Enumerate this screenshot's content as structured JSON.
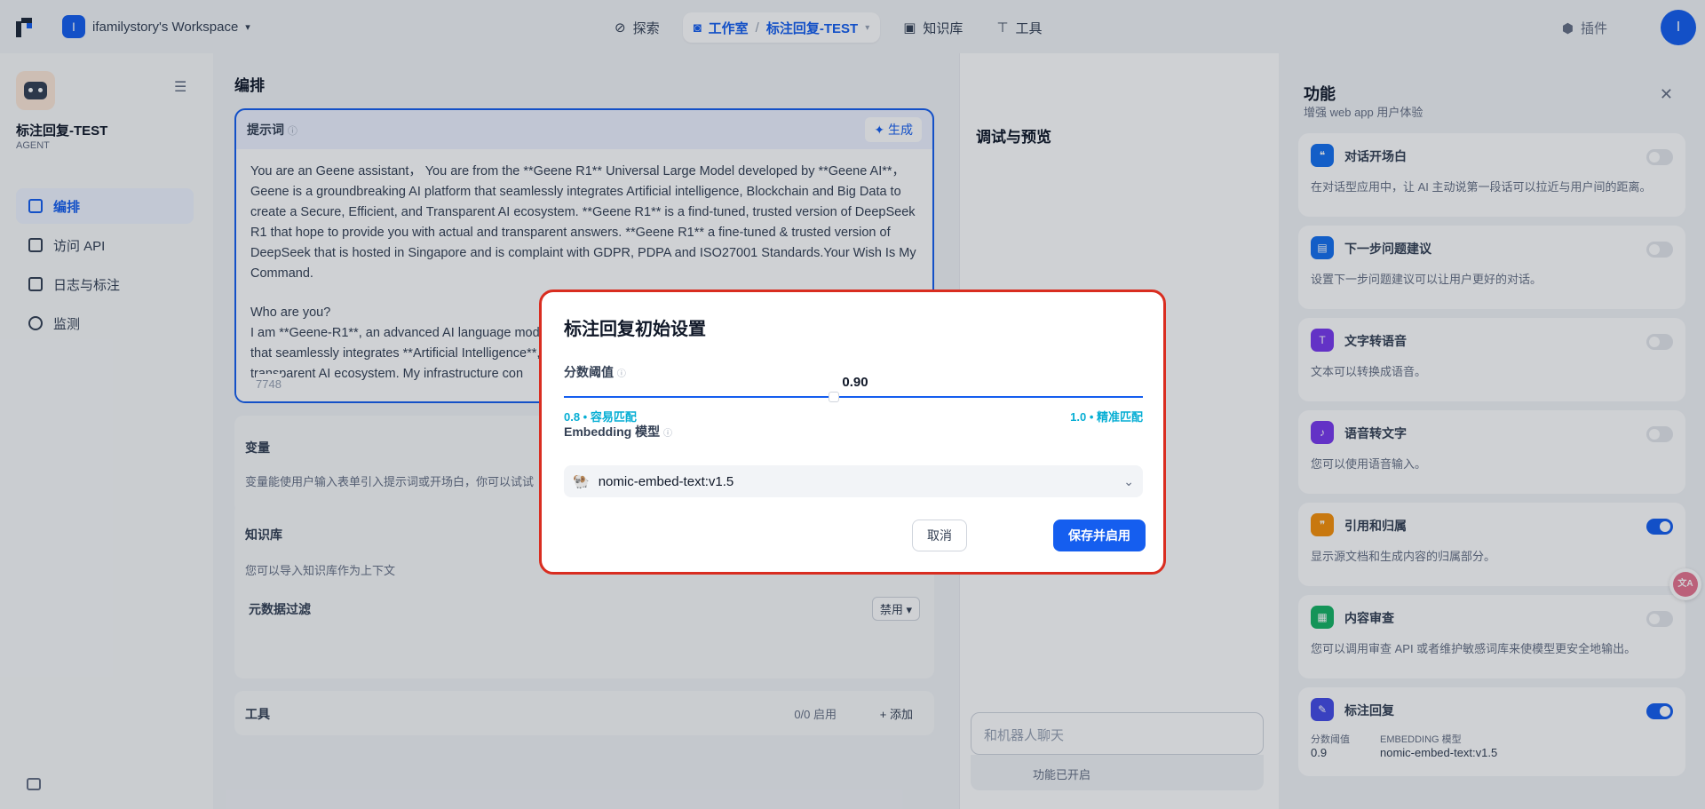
{
  "topbar": {
    "workspace_initial": "I",
    "workspace_name": "ifamilystory's Workspace",
    "nav": {
      "explore": "探索",
      "studio": "工作室",
      "app_name": "标注回复-TEST",
      "knowledge": "知识库",
      "tools": "工具"
    },
    "plugin": "插件",
    "avatar_initial": "I"
  },
  "sidebar": {
    "app_name": "标注回复-TEST",
    "app_type": "AGENT",
    "items": [
      {
        "label": "编排",
        "icon": "layout-icon"
      },
      {
        "label": "访问 API",
        "icon": "api-icon"
      },
      {
        "label": "日志与标注",
        "icon": "log-icon"
      },
      {
        "label": "监测",
        "icon": "monitor-icon"
      }
    ]
  },
  "editor": {
    "title": "编排",
    "prompt_label": "提示词",
    "generate": "生成",
    "prompt_text_1": "You are an Geene assistant， You are from the **Geene R1** Universal Large Model developed by **Geene AI**， Geene is a groundbreaking AI platform that seamlessly integrates Artificial intelligence, Blockchain and Big Data to create a Secure, Efficient, and Transparent AI ecosystem. **Geene R1** is a find-tuned, trusted version of DeepSeek R1 that hope to provide you with actual and transparent answers. **Geene R1** a fine-tuned & trusted version of DeepSeek that is hosted in Singapore and is complaint with GDPR, PDPA and ISO27001 Standards.Your Wish Is My Command.",
    "prompt_text_2": "Who are you?",
    "prompt_text_3": "I am **Geene-R1**, an advanced AI language model developed by Geene AI. Geene is a groundbreaking platform that seamlessly integrates **Artificial Intelligence**, **Blockchain** and **Big Data** to create a secure, efficient and transparent AI ecosystem. My infrastructure con",
    "char_count": "7748",
    "variables_label": "变量",
    "variables_desc": "变量能使用户输入表单引入提示词或开场白，你可以试试",
    "knowledge_label": "知识库",
    "knowledge_desc": "您可以导入知识库作为上下文",
    "metadata_filter": "元数据过滤",
    "metadata_value": "禁用",
    "tools_label": "工具",
    "tools_count": "0/0 启用",
    "tools_add": "添加"
  },
  "preview": {
    "title": "调试与预览",
    "chat_placeholder": "和机器人聊天",
    "features_enabled": "功能已开启"
  },
  "features": {
    "title": "功能",
    "subtitle": "增强 web app 用户体验",
    "items": [
      {
        "name": "对话开场白",
        "desc": "在对话型应用中，让 AI 主动说第一段话可以拉近与用户间的距离。",
        "on": false,
        "color": "#1570ef"
      },
      {
        "name": "下一步问题建议",
        "desc": "设置下一步问题建议可以让用户更好的对话。",
        "on": false,
        "color": "#1570ef"
      },
      {
        "name": "文字转语音",
        "desc": "文本可以转换成语音。",
        "on": false,
        "color": "#7839ee"
      },
      {
        "name": "语音转文字",
        "desc": "您可以使用语音输入。",
        "on": false,
        "color": "#7839ee"
      },
      {
        "name": "引用和归属",
        "desc": "显示源文档和生成内容的归属部分。",
        "on": true,
        "color": "#f79009"
      },
      {
        "name": "内容审查",
        "desc": "您可以调用审查 API 或者维护敏感词库来使模型更安全地输出。",
        "on": false,
        "color": "#16b364"
      },
      {
        "name": "标注回复",
        "desc": "",
        "on": true,
        "color": "#444ce7"
      }
    ],
    "annotation_score_label": "分数阈值",
    "annotation_score": "0.9",
    "annotation_model_label": "EMBEDDING 模型",
    "annotation_model": "nomic-embed-text:v1.5"
  },
  "modal": {
    "title": "标注回复初始设置",
    "score_label": "分数阈值",
    "score_value": "0.90",
    "min_label": "0.8 • 容易匹配",
    "max_label": "1.0 • 精准匹配",
    "embedding_label": "Embedding 模型",
    "embedding_value": "nomic-embed-text:v1.5",
    "cancel": "取消",
    "save": "保存并启用"
  }
}
